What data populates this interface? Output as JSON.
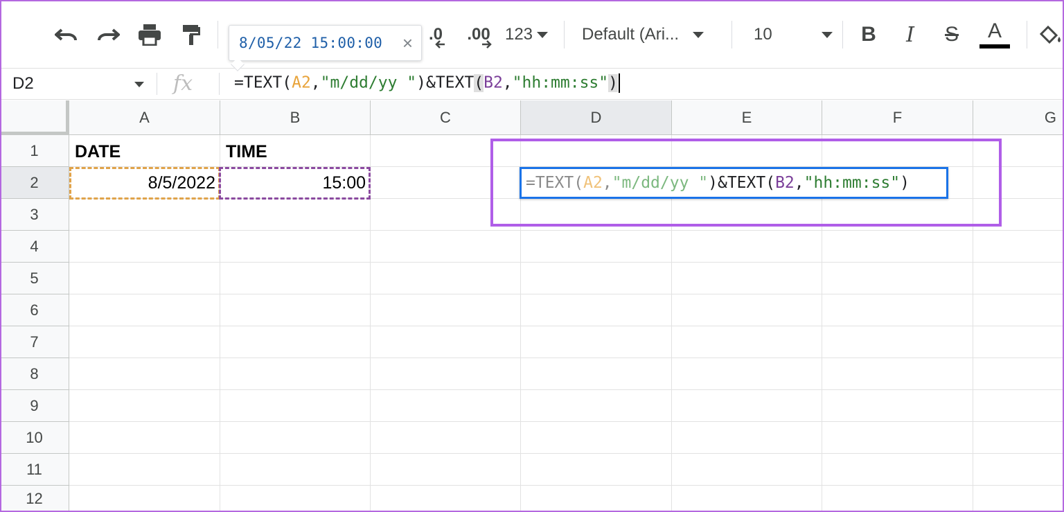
{
  "toolbar": {
    "decimal_decrease_label": ".0",
    "decimal_increase_label": ".00",
    "format_label": "123",
    "font_label": "Default (Ari...",
    "font_size_label": "10",
    "bold_label": "B",
    "italic_label": "I",
    "strike_label": "S",
    "text_color_label": "A",
    "text_color": "#000000"
  },
  "tooltip": {
    "value": "8/05/22 15:00:00",
    "close_glyph": "×"
  },
  "formula_bar": {
    "cell_ref": "D2",
    "fx_label": "fx",
    "formula": {
      "p1": "=TEXT(",
      "ref_a": "A2",
      "p2": ",",
      "str1": "\"m/dd/yy \"",
      "p3": ")&TEXT",
      "open_paren": "(",
      "ref_b": "B2",
      "p4": ",",
      "str2": "\"hh:mm:ss\"",
      "close_paren": ")"
    }
  },
  "grid": {
    "columns": [
      "A",
      "B",
      "C",
      "D",
      "E",
      "F",
      "G"
    ],
    "rows": [
      "1",
      "2",
      "3",
      "4",
      "5",
      "6",
      "7",
      "8",
      "9",
      "10",
      "11",
      "12"
    ],
    "cells": {
      "A1": "DATE",
      "B1": "TIME",
      "A2": "8/5/2022",
      "B2": "15:00"
    },
    "editor": {
      "p1": "=TEXT(",
      "ref_a": "A2",
      "p2": ",",
      "str1": "\"m/dd/yy \"",
      "p3": ")&TEXT(",
      "ref_b": "B2",
      "p4": ",",
      "str2": "\"hh:mm:ss\"",
      "p5": ")"
    }
  },
  "colors": {
    "ref_a": "#e8a33a",
    "ref_b": "#7b3f99",
    "string": "#2e7d32",
    "highlight_frame": "#b05ee8",
    "editor_border": "#1a73e8"
  }
}
